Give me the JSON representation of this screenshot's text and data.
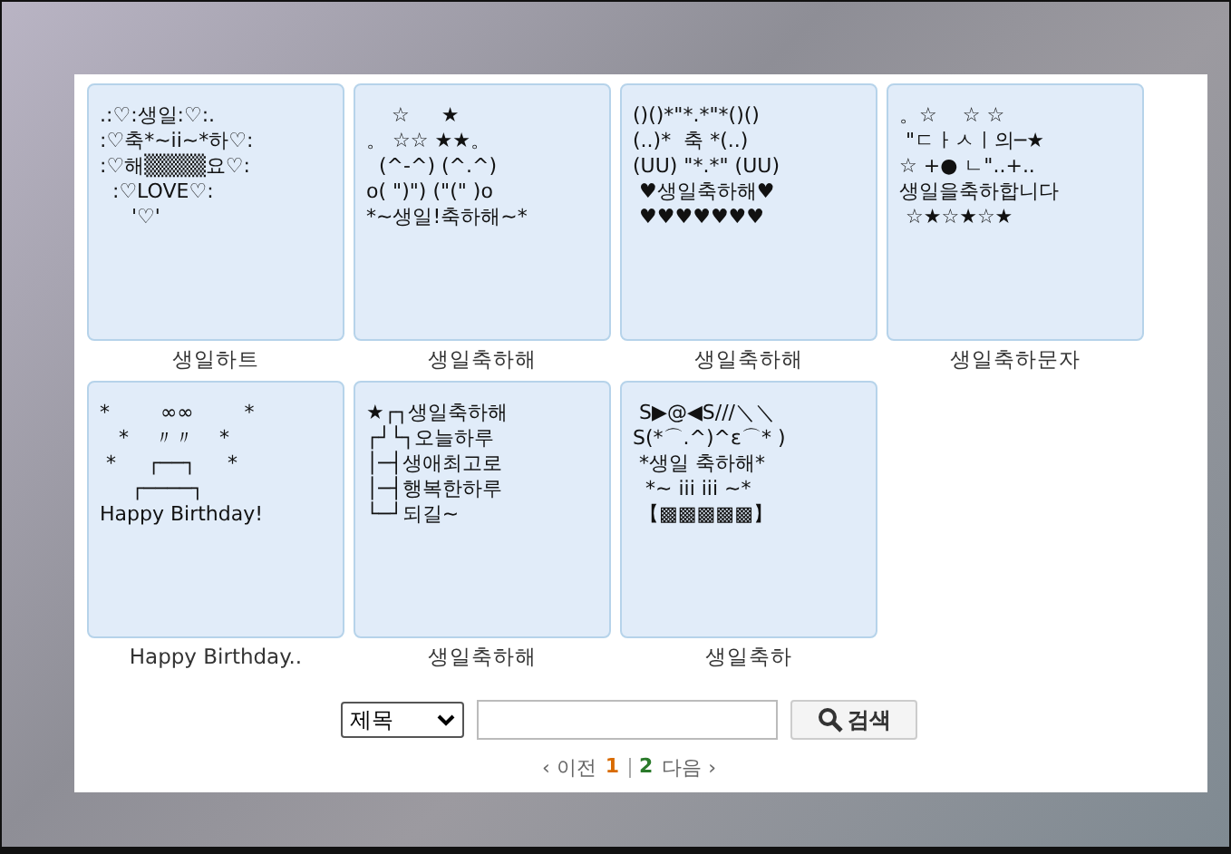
{
  "cards": [
    {
      "art": [
        ".:♡:생일:♡:.",
        ":♡축*~ii~*하♡:",
        ":♡해▒▒▒▒요♡:",
        "  :♡LOVE♡:",
        "     '♡'"
      ],
      "caption": "생일하트"
    },
    {
      "art": [
        "    ☆     ★",
        "。 ☆☆ ★★。",
        "  (^-^) (^.^)",
        "o( \")\") (\"(\" )o",
        "*~생일!축하해~*"
      ],
      "caption": "생일축하해"
    },
    {
      "art": [
        "()()*\"*.*\"*()()",
        "(..)*  축 *(..)",
        "(UU) \"*.*\" (UU)",
        " ♥생일축하해♥",
        " ♥♥♥♥♥♥♥"
      ],
      "caption": "생일축하해"
    },
    {
      "art": [
        "。☆    ☆ ☆",
        " \"ㄷㅏㅅㅣ의─★",
        "☆ +● ㄴ\"..+..",
        "생일을축하합니다",
        " ☆★☆★☆★"
      ],
      "caption": "생일축하문자"
    },
    {
      "art": [
        "*        ∞∞        *",
        "   *    〃〃    *",
        " *     ┌──┐     *",
        "     ┌────┐",
        "Happy Birthday!"
      ],
      "caption": "Happy Birthday.."
    },
    {
      "art": [
        "★┌┐생일축하해",
        "┌┘└┐오늘하루",
        "│─┤생애최고로",
        "│─┤행복한하루",
        "└─┘되길~"
      ],
      "caption": "생일축하해"
    },
    {
      "art": [
        " S▶@◀S///＼＼",
        "S(*⌒.^)^ε⌒* )",
        " *생일 축하해*",
        "  *~ iii iii ~*",
        " 【▩▩▩▩▩】"
      ],
      "caption": "생일축하"
    }
  ],
  "search": {
    "field": "제목",
    "button": "검색"
  },
  "pagination": {
    "prev": "‹ 이전",
    "pages": [
      {
        "label": "1",
        "selected": false
      },
      {
        "label": "2",
        "selected": true
      }
    ],
    "next": "다음 ›"
  }
}
